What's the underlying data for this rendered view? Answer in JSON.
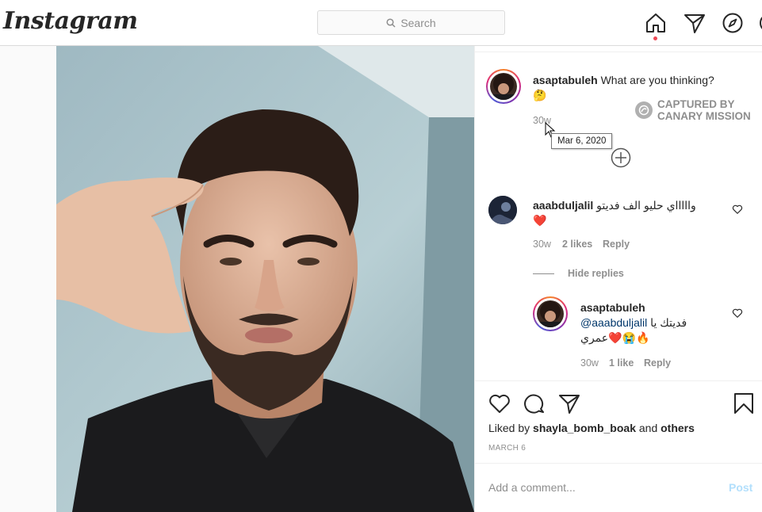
{
  "topbar": {
    "logo": "Instagram",
    "search_placeholder": "Search",
    "icons": [
      "home-icon",
      "direct-icon",
      "explore-icon"
    ]
  },
  "post": {
    "caption": {
      "username": "asaptabuleh",
      "text": "What are you thinking?",
      "emoji": "🤔",
      "age": "30w",
      "tooltip": "Mar 6, 2020"
    },
    "watermark": {
      "line1": "CAPTURED BY",
      "line2": "CANARY MISSION"
    },
    "comments": [
      {
        "username": "aaabduljalil",
        "text": "واااااي حليو الف فديتو",
        "emoji": "❤️",
        "age": "30w",
        "likes": "2 likes",
        "reply": "Reply",
        "hide_replies": "Hide replies",
        "replies": [
          {
            "username": "asaptabuleh",
            "mention": "@aaabduljalil",
            "text_ar1": "فديتك يا",
            "text_ar2": "عمري",
            "emoji": "❤️😭🔥",
            "age": "30w",
            "likes": "1 like",
            "reply": "Reply"
          }
        ]
      }
    ],
    "liked_by_prefix": "Liked by",
    "liked_by_user": "shayla_bomb_boak",
    "liked_by_and": "and",
    "liked_by_others": "others",
    "date": "MARCH 6",
    "add_comment_placeholder": "Add a comment...",
    "post_button": "Post"
  },
  "colors": {
    "link": "#00376b",
    "post_button": "#b2dffc",
    "notification_dot": "#ed4956",
    "heart": "#ed4956"
  }
}
